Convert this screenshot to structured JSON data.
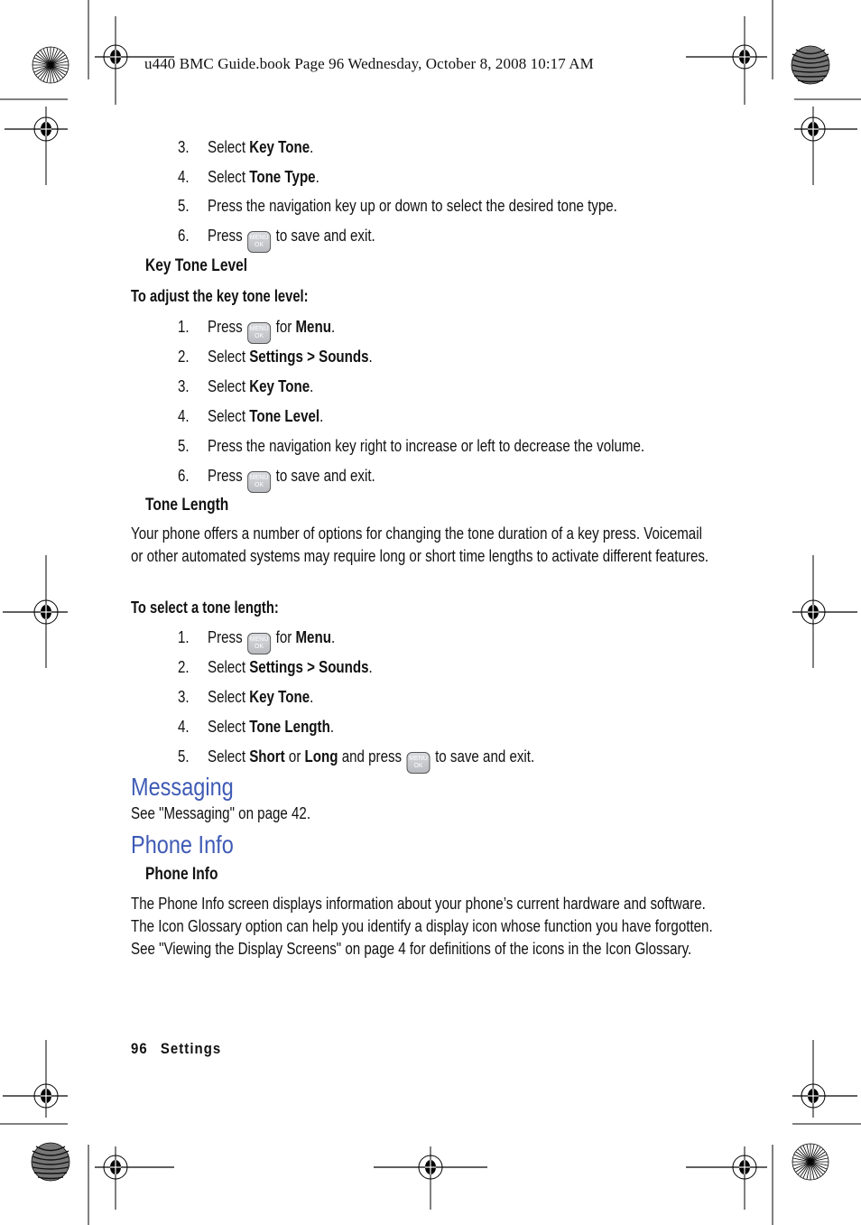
{
  "page_header": "u440 BMC Guide.book  Page 96  Wednesday, October 8, 2008  10:17 AM",
  "icons": {
    "menu_ok_key": {
      "semantic": "menu-ok-key-icon",
      "line1": "MENU",
      "line2": "OK"
    }
  },
  "tone_type_steps": [
    {
      "num": "3.",
      "pre": "Select ",
      "bold": "Key Tone",
      "post": "."
    },
    {
      "num": "4.",
      "pre": "Select ",
      "bold": "Tone Type",
      "post": "."
    },
    {
      "num": "5.",
      "text": "Press the navigation key up or down to select the desired tone type."
    },
    {
      "num": "6.",
      "pre": "Press ",
      "post": " to save and exit."
    }
  ],
  "key_tone_level": {
    "heading": "Key Tone Level",
    "procedure_title": "To adjust the key tone level:",
    "steps": [
      {
        "num": "1.",
        "pre": "Press ",
        "mid": " for ",
        "bold": "Menu",
        "post": "."
      },
      {
        "num": "2.",
        "pre": "Select ",
        "bold": "Settings > Sounds",
        "post": "."
      },
      {
        "num": "3.",
        "pre": "Select ",
        "bold": "Key Tone",
        "post": "."
      },
      {
        "num": "4.",
        "pre": "Select ",
        "bold": "Tone Level",
        "post": "."
      },
      {
        "num": "5.",
        "text": "Press the navigation key right to increase or left to decrease the volume."
      },
      {
        "num": "6.",
        "pre": "Press ",
        "post": " to save and exit."
      }
    ]
  },
  "tone_length": {
    "heading": "Tone Length",
    "paragraph": "Your phone offers a number of options for changing the tone duration of a key press. Voicemail or other automated systems may require long or short time lengths to activate different features.",
    "procedure_title": "To select a tone length:",
    "steps": [
      {
        "num": "1.",
        "pre": "Press ",
        "mid": " for ",
        "bold": "Menu",
        "post": "."
      },
      {
        "num": "2.",
        "pre": "Select ",
        "bold": "Settings > Sounds",
        "post": "."
      },
      {
        "num": "3.",
        "pre": "Select ",
        "bold": "Key Tone",
        "post": "."
      },
      {
        "num": "4.",
        "pre": "Select ",
        "bold": "Tone Length",
        "post": "."
      },
      {
        "num": "5.",
        "pre": "Select ",
        "bold": "Short",
        "mid": " or ",
        "bold2": "Long",
        "mid2": " and press ",
        "post": " to save and exit."
      }
    ]
  },
  "messaging": {
    "heading": "Messaging",
    "text": "See \"Messaging\" on page 42."
  },
  "phone_info": {
    "heading": "Phone Info",
    "subheading": "Phone Info",
    "paragraph": "The Phone Info screen displays information about your phone’s current hardware and software. The Icon Glossary option can help you identify a display icon whose function you have forgotten. See \"Viewing the Display Screens\" on page 4 for definitions of the icons in the Icon Glossary."
  },
  "footer": {
    "page_number": "96",
    "section": "Settings"
  },
  "colors": {
    "heading_blue": "#3f5bb5",
    "text": "#111111"
  }
}
